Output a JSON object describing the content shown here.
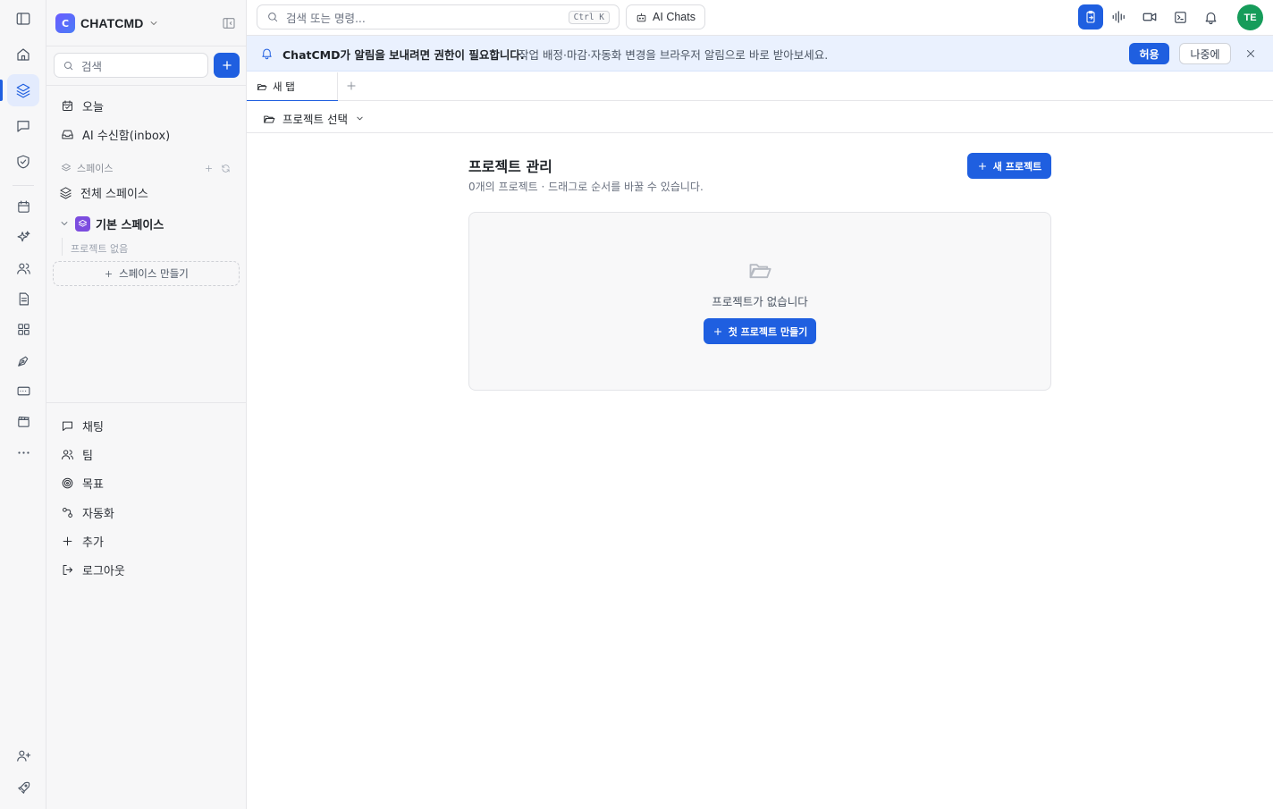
{
  "brand": {
    "logo_letter": "C",
    "name": "CHATCMD"
  },
  "sidebar": {
    "search_placeholder": "검색",
    "nav": [
      {
        "label": "오늘",
        "icon": "calendar-icon"
      },
      {
        "label": "AI 수신함(inbox)",
        "icon": "inbox-icon"
      }
    ],
    "spaces_header": "스페이스",
    "all_spaces": "전체 스페이스",
    "default_space": "기본 스페이스",
    "no_projects": "프로젝트 없음",
    "create_space": "스페이스 만들기",
    "bottom_nav": [
      {
        "label": "채팅",
        "icon": "chat-icon"
      },
      {
        "label": "팀",
        "icon": "team-icon"
      },
      {
        "label": "목표",
        "icon": "target-icon"
      },
      {
        "label": "자동화",
        "icon": "automation-icon"
      },
      {
        "label": "추가",
        "icon": "plus-icon"
      },
      {
        "label": "로그아웃",
        "icon": "logout-icon"
      }
    ]
  },
  "topbar": {
    "search_placeholder": "검색 또는 명령...",
    "shortcut": "Ctrl K",
    "ai_chats": "AI Chats",
    "avatar_initials": "TE"
  },
  "banner": {
    "title": "ChatCMD가 알림을 보내려면 권한이 필요합니다.",
    "description": "작업 배정·마감·자동화 변경을 브라우저 알림으로 바로 받아보세요.",
    "allow": "허용",
    "later": "나중에"
  },
  "tabs": [
    {
      "label": "새 탭",
      "active": true
    }
  ],
  "project_selector": "프로젝트 선택",
  "main": {
    "title": "프로젝트 관리",
    "subtitle": "0개의 프로젝트 · 드래그로 순서를 바꿀 수 있습니다.",
    "new_project": "새 프로젝트",
    "empty_text": "프로젝트가 없습니다",
    "first_project": "첫 프로젝트 만들기"
  },
  "colors": {
    "accent": "#1f5fe0",
    "avatar": "#169c5a",
    "space_badge": "#7c4ddf",
    "banner_bg": "#eaf1fe"
  }
}
